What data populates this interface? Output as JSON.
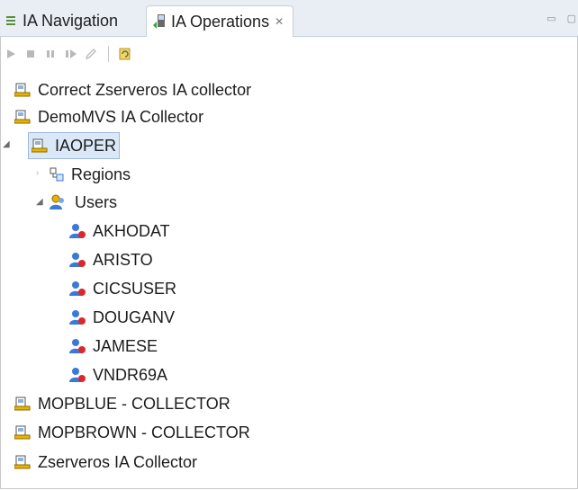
{
  "tabs": [
    {
      "label": "IA Navigation",
      "icon": "navigation-icon",
      "active": false
    },
    {
      "label": "IA Operations",
      "icon": "operations-icon",
      "active": true
    }
  ],
  "tab_close_glyph": "✕",
  "toolbar": {
    "buttons": [
      "start-icon",
      "stop-icon",
      "pause-icon",
      "resume-icon",
      "edit-icon",
      "refresh-icon"
    ]
  },
  "tree": {
    "items": [
      {
        "label": "Correct Zserveros IA collector",
        "type": "collector"
      },
      {
        "label": "DemoMVS IA Collector",
        "type": "collector"
      },
      {
        "label": "IAOPER",
        "type": "collector",
        "expanded": true,
        "selected": true,
        "children": [
          {
            "label": "Regions",
            "type": "regions",
            "expanded": false
          },
          {
            "label": "Users",
            "type": "users",
            "expanded": true,
            "children": [
              "AKHODAT",
              "ARISTO",
              "CICSUSER",
              "DOUGANV",
              "JAMESE",
              "VNDR69A"
            ]
          }
        ]
      },
      {
        "label": "MOPBLUE  - COLLECTOR",
        "type": "collector"
      },
      {
        "label": "MOPBROWN  - COLLECTOR",
        "type": "collector"
      },
      {
        "label": "Zserveros IA Collector",
        "type": "collector"
      }
    ]
  },
  "colors": {
    "tabbar_bg": "#e9eef5",
    "selection_bg": "#dbe8f7",
    "collector_icon_yellow": "#e8b400",
    "user_icon_blue": "#3c78d8",
    "user_icon_red": "#d92a2a"
  }
}
